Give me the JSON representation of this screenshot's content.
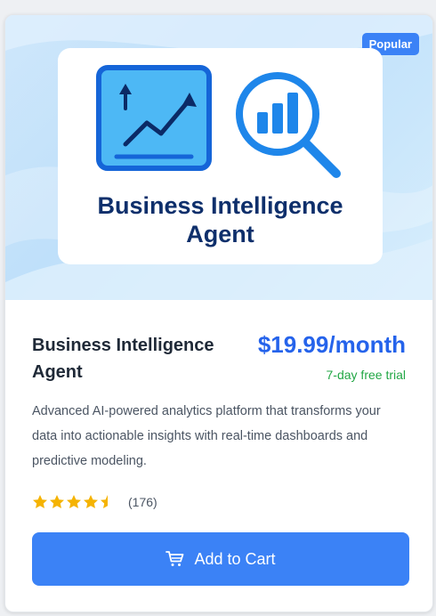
{
  "product": {
    "badge": "Popular",
    "logo_line1": "Business Intelligence",
    "logo_line2": "Agent",
    "name": "Business Intelligence Agent",
    "price": "$19.99/month",
    "trial": "7-day free trial",
    "description": "Advanced AI-powered analytics platform that transforms your data into actionable insights with real-time dashboards and predictive modeling.",
    "rating": 4.5,
    "review_count": "(176)",
    "cart_label": "Add to Cart"
  },
  "icons": {
    "trend": "chart-trend-icon",
    "analytics": "magnifier-bars-icon",
    "cart": "cart-icon",
    "star": "star-icon"
  },
  "colors": {
    "accent": "#3b82f6",
    "price": "#2563eb",
    "trial": "#22a745",
    "star": "#f5b301",
    "logo_text": "#0e2f6b"
  }
}
